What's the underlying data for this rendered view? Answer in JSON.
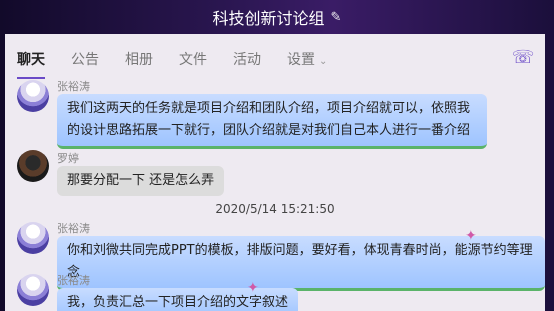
{
  "window": {
    "title": "科技创新讨论组"
  },
  "tabs": [
    {
      "label": "聊天"
    },
    {
      "label": "公告"
    },
    {
      "label": "相册"
    },
    {
      "label": "文件"
    },
    {
      "label": "活动"
    },
    {
      "label": "设置"
    }
  ],
  "messages": [
    {
      "sender": "张裕涛",
      "text": "我们这两天的任务就是项目介绍和团队介绍，项目介绍就可以，依照我的设计思路拓展一下就行，团队介绍就是对我们自己本人进行一番介绍"
    },
    {
      "sender": "罗婷",
      "text": "那要分配一下 还是怎么弄"
    },
    {
      "time": "2020/5/14 15:21:50"
    },
    {
      "sender": "张裕涛",
      "text": "你和刘微共同完成PPT的模板，排版问题，要好看，体现青春时尚，能源节约等理念"
    },
    {
      "sender": "张裕涛",
      "text": "我，负责汇总一下项目介绍的文字叙述"
    }
  ],
  "colors": {
    "accent": "#6a4ac7",
    "bubble_blue": "#9ec4ff",
    "bubble_gray": "#dcdcdc"
  },
  "icons": {
    "edit": "pencil-icon",
    "call": "phone-icon"
  }
}
